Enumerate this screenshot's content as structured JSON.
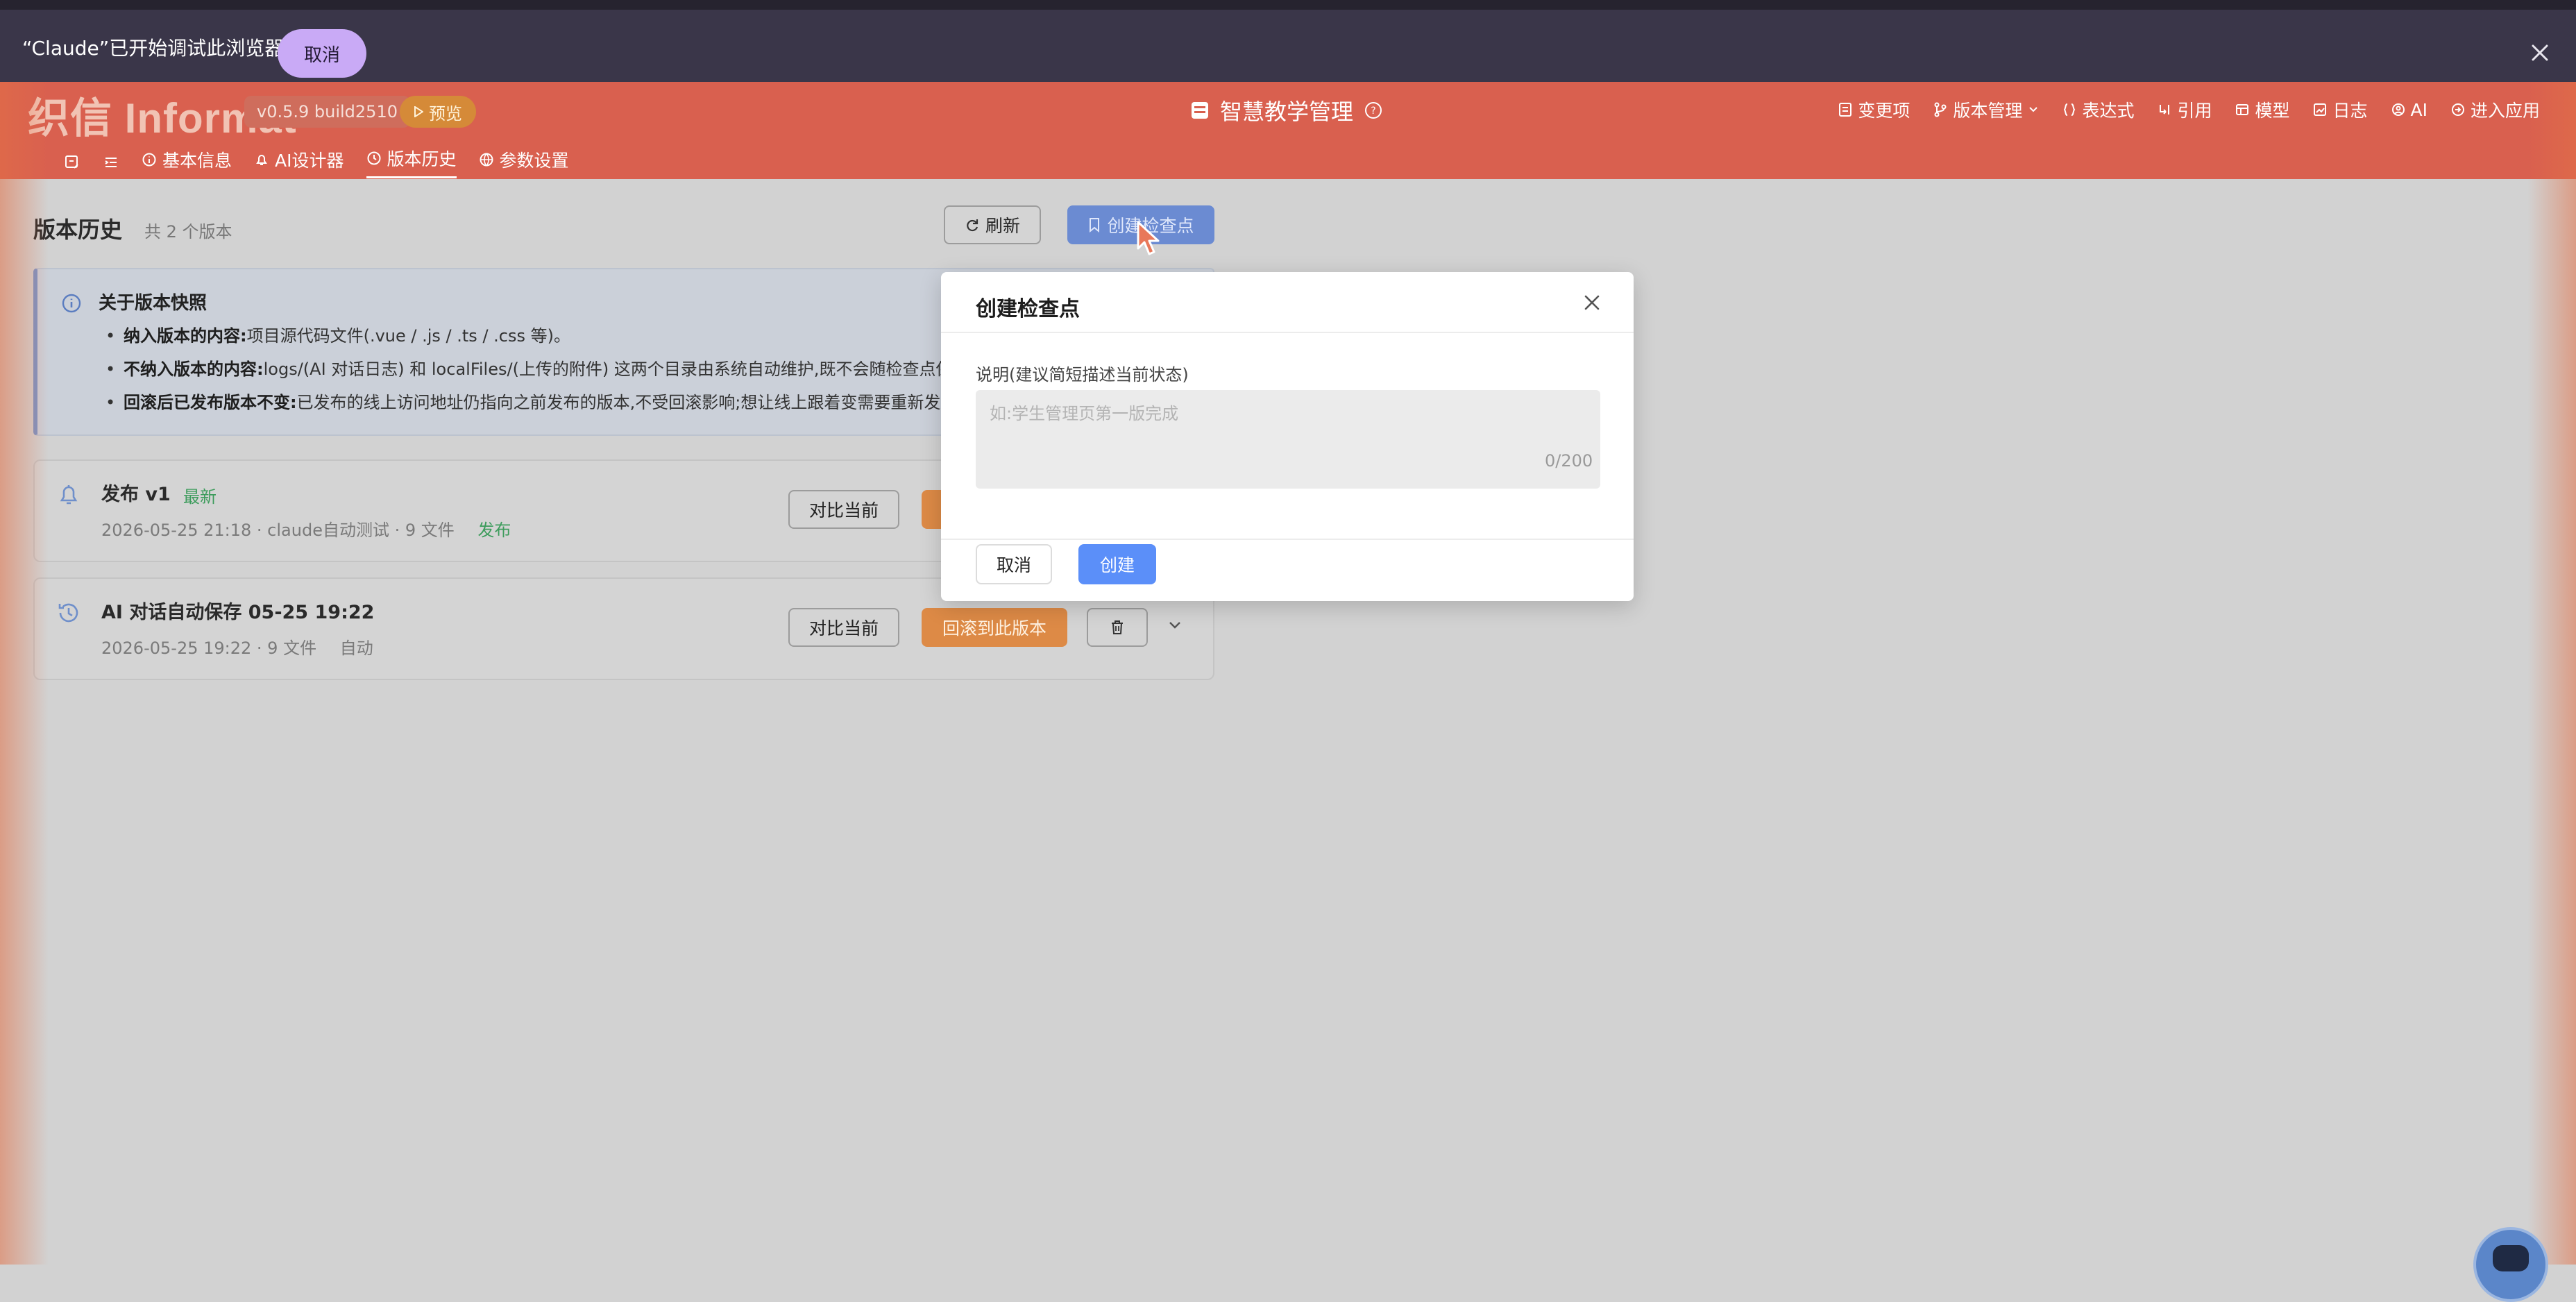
{
  "debug_banner": {
    "message": "“Claude”已开始调试此浏览器",
    "cancel_label": "取消"
  },
  "header": {
    "logo": "织信 Informat",
    "version": "v0.5.9 build2510",
    "preview_label": "预览",
    "app_title": "智慧教学管理",
    "menu": [
      "变更项",
      "版本管理",
      "表达式",
      "引用",
      "模型",
      "日志",
      "AI",
      "进入应用"
    ]
  },
  "subnav": {
    "items": [
      "基本信息",
      "AI设计器",
      "版本历史",
      "参数设置"
    ],
    "active": "版本历史"
  },
  "page": {
    "title": "版本历史",
    "count": "共 2 个版本",
    "refresh_label": "刷新",
    "create_checkpoint_label": "创建检查点"
  },
  "info": {
    "title": "关于版本快照",
    "items": [
      {
        "bold": "纳入版本的内容:",
        "text": "项目源代码文件(.vue / .js / .ts / .css 等)。"
      },
      {
        "bold": "不纳入版本的内容:",
        "text": "logs/(AI 对话日志) 和 localFiles/(上传的附件) 这两个目录由系统自动维护,既不会随检查点保存"
      },
      {
        "bold": "回滚后已发布版本不变:",
        "text": "已发布的线上访问地址仍指向之前发布的版本,不受回滚影响;想让线上跟着变需要重新发布"
      }
    ]
  },
  "versions": [
    {
      "name": "发布 v1",
      "badge": "最新",
      "time": "2026-05-25 21:18",
      "author": "· claude自动测试",
      "files": "· 9 文件",
      "tag": "发布",
      "compare_label": "对比当前",
      "rollback_label": ""
    },
    {
      "name": "AI 对话自动保存 05-25 19:22",
      "badge": "",
      "time": "2026-05-25 19:22",
      "author": "",
      "files": "· 9 文件",
      "tag": "自动",
      "compare_label": "对比当前",
      "rollback_label": "回滚到此版本"
    }
  ],
  "modal": {
    "title": "创建检查点",
    "field_label": "说明(建议简短描述当前状态)",
    "placeholder": "如:学生管理页第一版完成",
    "value": "",
    "counter": "0/200",
    "cancel_label": "取消",
    "create_label": "创建"
  },
  "colors": {
    "header_bg": "#d9604f",
    "primary": "#5b8ff9",
    "rollback": "#dd8a46",
    "success_text": "#3d9c5c",
    "debug_bar": "#3a3649",
    "debug_cancel": "#c9aaf6"
  }
}
